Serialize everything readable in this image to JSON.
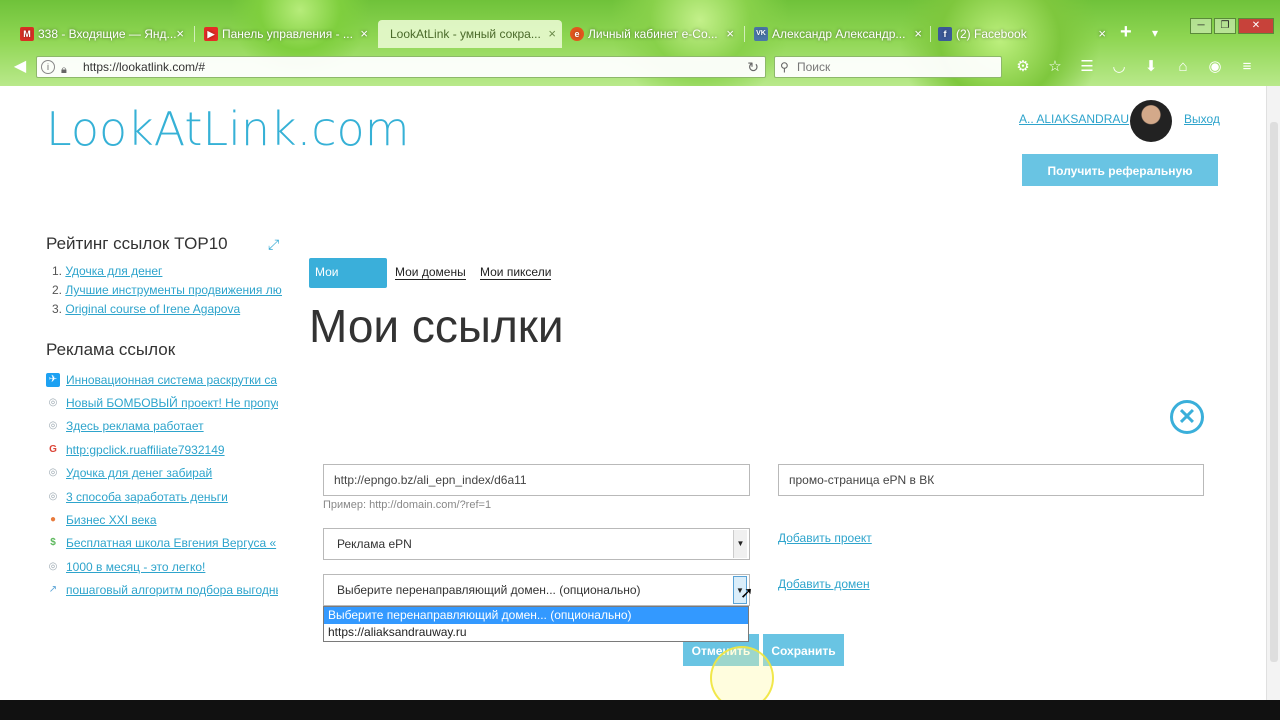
{
  "browser": {
    "tabs": [
      {
        "title": "338 - Входящие — Янд...",
        "icon": "gmail-icon",
        "icon_color": "#d93025",
        "icon_char": "M"
      },
      {
        "title": "Панель управления - ...",
        "icon": "youtube-icon",
        "icon_color": "#e52d27",
        "icon_char": "▶"
      },
      {
        "title": "LookAtLink - умный сокра...",
        "icon": "",
        "icon_color": "",
        "icon_char": ""
      },
      {
        "title": "Личный кабинет e-Co...",
        "icon": "epn-icon",
        "icon_color": "#e2561e",
        "icon_char": "e"
      },
      {
        "title": "Александр Александр...",
        "icon": "vk-icon",
        "icon_color": "#4a76a8",
        "icon_char": "VK"
      },
      {
        "title": "(2) Facebook",
        "icon": "facebook-icon",
        "icon_color": "#3b5998",
        "icon_char": "f"
      }
    ],
    "new_tab": "+",
    "url": "https://lookatlink.com/#",
    "search_placeholder": "Поиск"
  },
  "header": {
    "logo": "LookAtLink.com",
    "user_name": "A.. ALIAKSANDRAU",
    "logout": "Выход",
    "referral_button": "Получить реферальную ссылку"
  },
  "sidebar": {
    "top_title": "Рейтинг ссылок TOP10",
    "top_links": [
      {
        "num": "1.",
        "label": "Удочка для денег"
      },
      {
        "num": "2.",
        "label": "Лучшие инструменты продвижения люб"
      },
      {
        "num": "3.",
        "label": "Original course of Irene Agapova"
      }
    ],
    "ads_title": "Реклама ссылок",
    "ads": [
      {
        "label": "Инновационная система раскрутки са",
        "icon": "twitter-icon",
        "color": "#1da1f2",
        "char": "✈"
      },
      {
        "label": "Новый БОМБОВЫЙ проект! Не пропусти",
        "icon": "globe-icon",
        "color": "#9aa7b0",
        "char": "◎"
      },
      {
        "label": "Здесь реклама работает",
        "icon": "globe-icon",
        "color": "#9aa7b0",
        "char": "◎"
      },
      {
        "label": "http:gpclick.ruaffiliate7932149",
        "icon": "google-icon",
        "color": "#db4437",
        "char": "G"
      },
      {
        "label": "Удочка для денег забирай",
        "icon": "globe-icon",
        "color": "#9aa7b0",
        "char": "◎"
      },
      {
        "label": "3 способа заработать деньги",
        "icon": "globe-icon",
        "color": "#9aa7b0",
        "char": "◎"
      },
      {
        "label": "Бизнес XXI века",
        "icon": "chrome-like-icon",
        "color": "#e87b3c",
        "char": "●"
      },
      {
        "label": "Бесплатная школа Евгения Вергуса «",
        "icon": "dollar-icon",
        "color": "#5cb85c",
        "char": "$"
      },
      {
        "label": "1000 в месяц - это легко!",
        "icon": "globe-icon",
        "color": "#9aa7b0",
        "char": "◎"
      },
      {
        "label": "пошаговый алгоритм подбора выгодны",
        "icon": "chart-icon",
        "color": "#5aa3d6",
        "char": "↗"
      }
    ]
  },
  "main": {
    "tabs": [
      {
        "label": "Мои ссылки"
      },
      {
        "label": "Мои домены"
      },
      {
        "label": "Мои пиксели"
      }
    ],
    "title": "Мои ссылки",
    "form": {
      "url_value": "http://epngo.bz/ali_epn_index/d6a11",
      "name_value": "промо-страница ePN в ВК",
      "hint": "Пример: http://domain.com/?ref=1",
      "project_selected": "Реклама ePN",
      "add_project": "Добавить проект",
      "domain_selected": "Выберите перенаправляющий домен... (опционально)",
      "add_domain": "Добавить домен",
      "domain_options": [
        "Выберите перенаправляющий домен... (опционально)",
        "https://aliaksandrauway.ru"
      ],
      "cancel": "Отменить",
      "save": "Сохранить"
    }
  },
  "colors": {
    "accent": "#3aafda",
    "link": "#2ea4cc",
    "button": "#69c4e3"
  }
}
